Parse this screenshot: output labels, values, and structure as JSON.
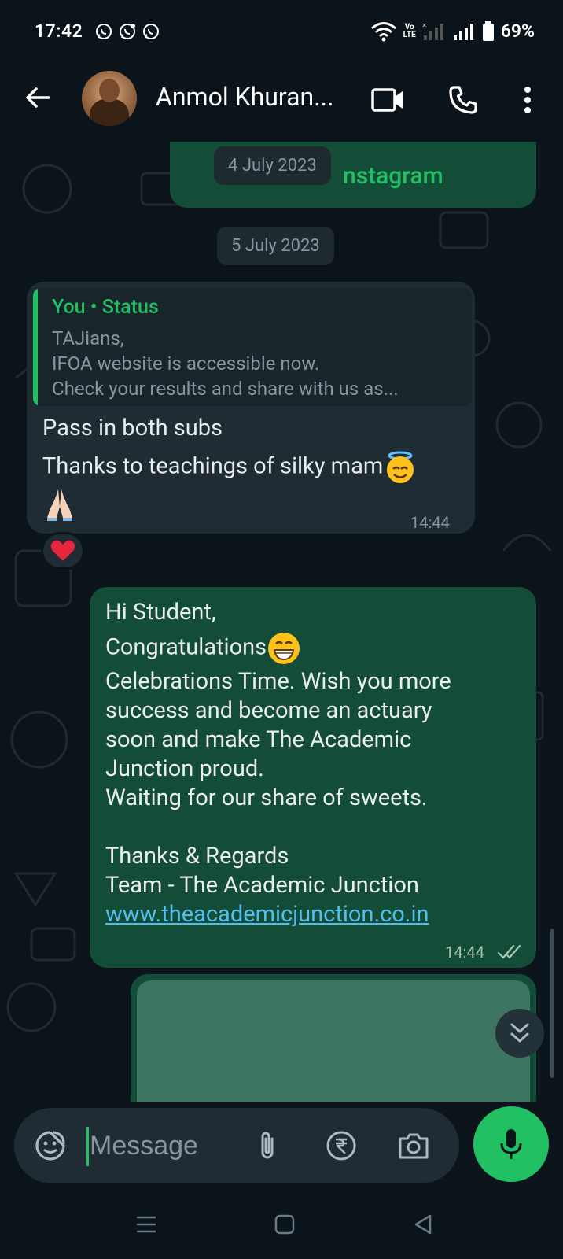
{
  "status_bar": {
    "time": "17:42",
    "battery": "69%",
    "volte_top": "Vo",
    "volte_bottom": "LTE",
    "icons": [
      "whatsapp-icon",
      "whatsapp-business-icon",
      "whatsapp-icon",
      "wifi-icon",
      "volte-icon",
      "signal-icon",
      "signal-icon",
      "battery-icon"
    ]
  },
  "header": {
    "contact_name": "Anmol Khuran...",
    "icons": [
      "back-arrow-icon",
      "video-call-icon",
      "phone-icon",
      "more-vertical-icon"
    ]
  },
  "chat": {
    "top_partial_text": "nstagram",
    "date_1": "4 July 2023",
    "date_2": "5 July 2023",
    "incoming": {
      "quote_title": "You • Status",
      "quote_line_1": "TAJians,",
      "quote_line_2": "IFOA website is accessible now.",
      "quote_line_3": "Check your results and share with us as...",
      "line_1": "Pass in both subs",
      "line_2": "Thanks to teachings of silky mam",
      "time": "14:44",
      "reaction": "heart-emoji"
    },
    "outgoing": {
      "lines": [
        "Hi Student,",
        "Congratulations",
        "Celebrations Time. Wish you more",
        "success and become an actuary",
        "soon and make The Academic",
        "Junction proud.",
        "Waiting for our share of sweets.",
        "Thanks & Regards",
        "Team - The Academic Junction"
      ],
      "link": "www.theacademicjunction.co.in",
      "time": "14:44"
    }
  },
  "composer": {
    "placeholder": "Message",
    "icons": [
      "sticker-icon",
      "attach-icon",
      "rupee-payment-icon",
      "camera-icon",
      "mic-icon"
    ]
  },
  "colors": {
    "background": "#0b141a",
    "outgoing_bubble": "#134d37",
    "incoming_bubble": "#1f2c34",
    "accent_green": "#21c063",
    "link_blue": "#53bdeb"
  }
}
